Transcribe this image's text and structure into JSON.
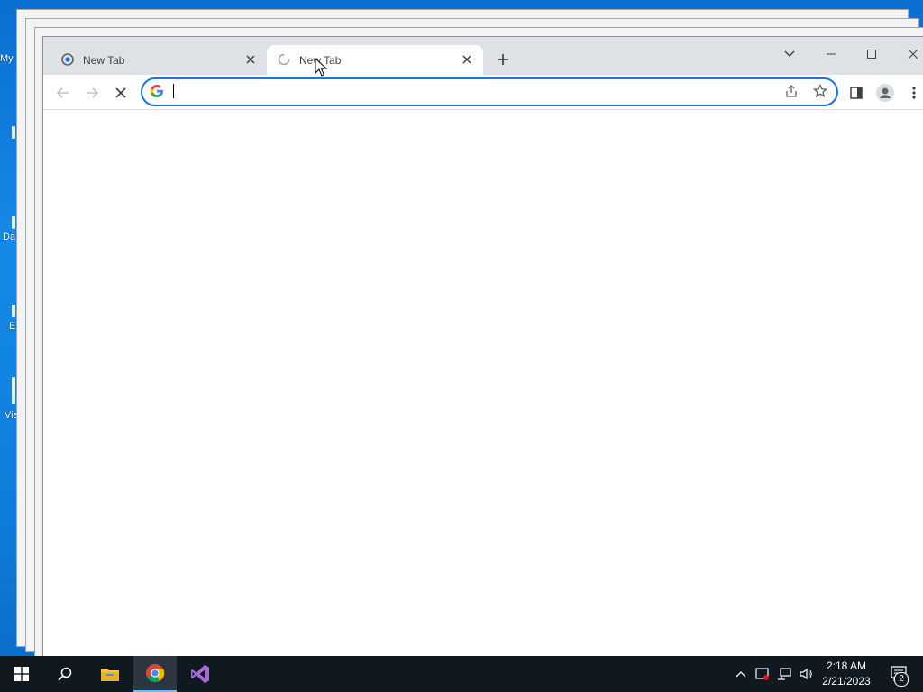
{
  "desktop": {
    "icon_labels": [
      "My",
      "Da",
      "E",
      "Vis"
    ]
  },
  "browser": {
    "tabs": [
      {
        "title": "New Tab",
        "state": "idle",
        "favicon": "chrome-icon"
      },
      {
        "title": "New Tab",
        "state": "loading",
        "favicon": "loading-spinner-icon"
      }
    ],
    "active_tab_index": 1,
    "address_bar": {
      "value": "",
      "placeholder": ""
    },
    "icons": {
      "back": "back-arrow-icon",
      "forward": "forward-arrow-icon",
      "stop": "stop-icon",
      "share": "share-icon",
      "bookmark": "star-icon",
      "side_panel": "side-panel-icon",
      "profile": "profile-icon",
      "menu": "kebab-menu-icon"
    },
    "colors": {
      "accent": "#1a73e8",
      "titlebar": "#dee1e6"
    }
  },
  "taskbar": {
    "apps": [
      "start-icon",
      "search-icon",
      "file-explorer-icon",
      "chrome-icon",
      "visual-studio-icon"
    ],
    "clock": {
      "time": "2:18 AM",
      "date": "2/21/2023"
    },
    "notification_count": "2"
  }
}
